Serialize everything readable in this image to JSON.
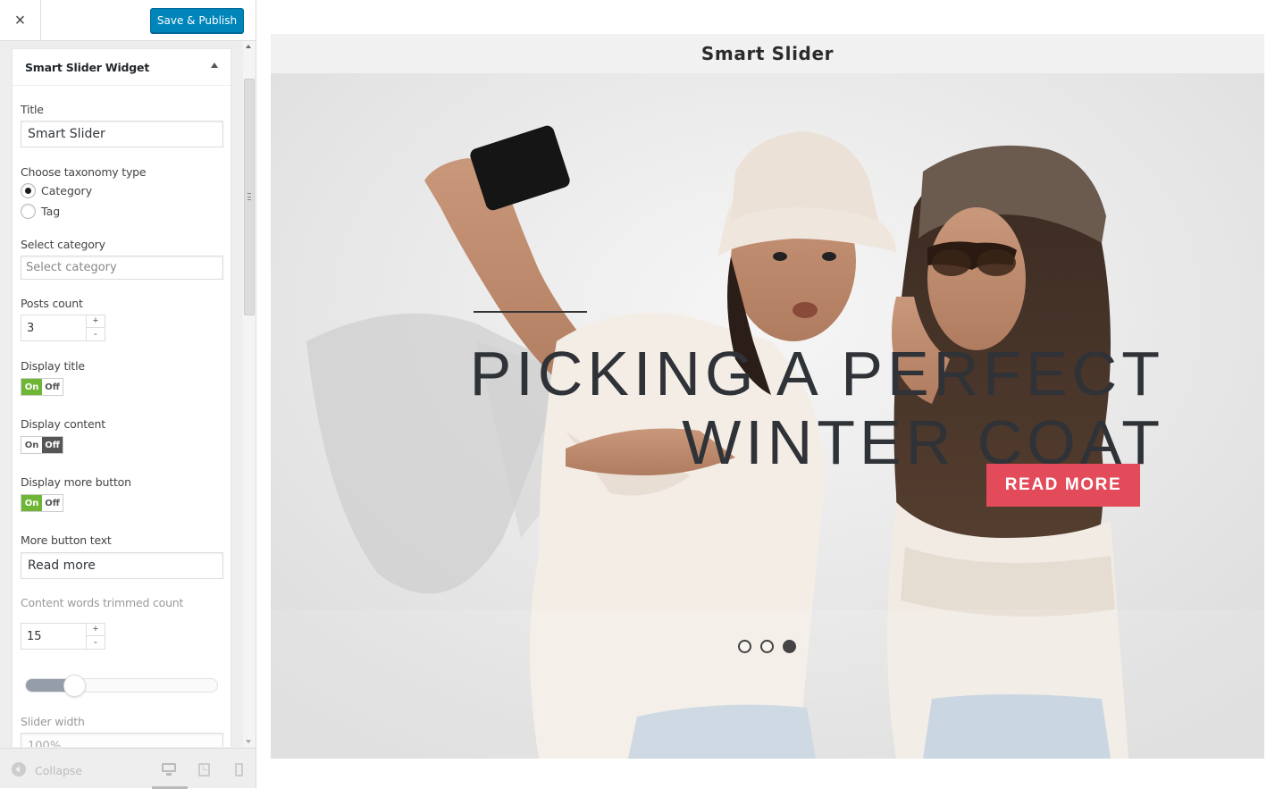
{
  "header": {
    "close_label": "×",
    "publish_label": "Save & Publish"
  },
  "widget": {
    "title": "Smart Slider Widget",
    "fields": {
      "title_label": "Title",
      "title_value": "Smart Slider",
      "taxonomy_label": "Choose taxonomy type",
      "taxonomy_options": [
        "Category",
        "Tag"
      ],
      "taxonomy_selected": "Category",
      "category_label": "Select category",
      "category_placeholder": "Select category",
      "posts_count_label": "Posts count",
      "posts_count_value": "3",
      "display_title_label": "Display title",
      "display_title": true,
      "display_content_label": "Display content",
      "display_content": false,
      "display_more_label": "Display more button",
      "display_more": true,
      "toggle_on": "On",
      "toggle_off": "Off",
      "more_text_label": "More button text",
      "more_text_value": "Read more",
      "trim_label": "Content words trimmed count",
      "trim_value": "15",
      "stepper_plus": "+",
      "stepper_minus": "-",
      "range_fraction": 0.25,
      "slider_width_label": "Slider width",
      "slider_width_value": "100%"
    }
  },
  "footer": {
    "collapse_label": "Collapse"
  },
  "preview": {
    "slider_title": "Smart Slider",
    "slide_heading_line1": "Picking a perfect",
    "slide_heading_line2": "winter coat",
    "read_more_label": "Read more",
    "dots_count": 3,
    "active_dot": 3
  },
  "colors": {
    "publish": "#0085ba",
    "toggle_on": "#6fb536",
    "read_more": "#e34b5a"
  }
}
